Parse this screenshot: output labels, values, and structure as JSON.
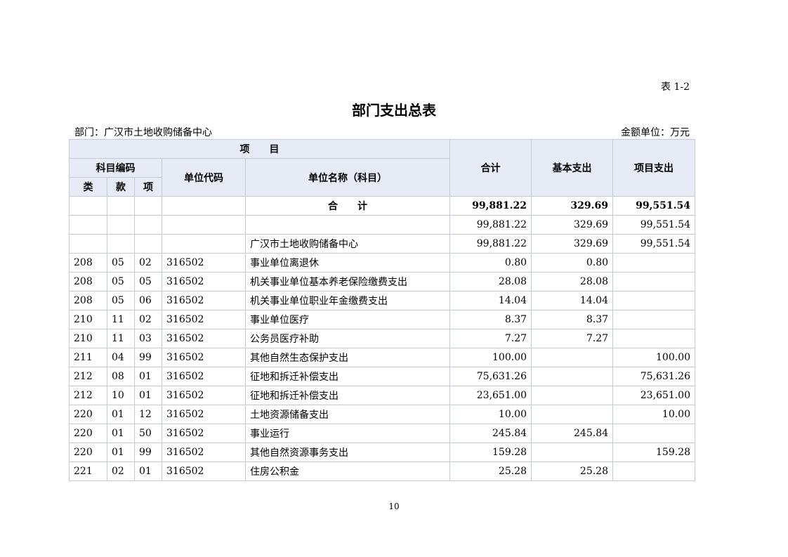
{
  "header": {
    "table_no": "表 1-2",
    "title": "部门支出总表",
    "dept": "部门：广汉市土地收购储备中心",
    "unit": "金额单位：万元"
  },
  "columns": {
    "project": "项　　目",
    "subject_code": "科目编码",
    "lei": "类",
    "kuan": "款",
    "xiang": "项",
    "unit_code": "单位代码",
    "unit_name": "单位名称（科目）",
    "total": "合计",
    "basic": "基本支出",
    "project_exp": "项目支出"
  },
  "total_row": {
    "label": "合　　计",
    "total": "99,881.22",
    "basic": "329.69",
    "project": "99,551.54"
  },
  "rows": [
    {
      "lei": "",
      "kuan": "",
      "xiang": "",
      "code": "",
      "name": "",
      "total": "99,881.22",
      "basic": "329.69",
      "project": "99,551.54"
    },
    {
      "lei": "",
      "kuan": "",
      "xiang": "",
      "code": "",
      "name": "广汉市土地收购储备中心",
      "total": "99,881.22",
      "basic": "329.69",
      "project": "99,551.54"
    },
    {
      "lei": "208",
      "kuan": "05",
      "xiang": "02",
      "code": "316502",
      "name": "事业单位离退休",
      "total": "0.80",
      "basic": "0.80",
      "project": ""
    },
    {
      "lei": "208",
      "kuan": "05",
      "xiang": "05",
      "code": "316502",
      "name": "机关事业单位基本养老保险缴费支出",
      "total": "28.08",
      "basic": "28.08",
      "project": ""
    },
    {
      "lei": "208",
      "kuan": "05",
      "xiang": "06",
      "code": "316502",
      "name": "机关事业单位职业年金缴费支出",
      "total": "14.04",
      "basic": "14.04",
      "project": ""
    },
    {
      "lei": "210",
      "kuan": "11",
      "xiang": "02",
      "code": "316502",
      "name": "事业单位医疗",
      "total": "8.37",
      "basic": "8.37",
      "project": ""
    },
    {
      "lei": "210",
      "kuan": "11",
      "xiang": "03",
      "code": "316502",
      "name": "公务员医疗补助",
      "total": "7.27",
      "basic": "7.27",
      "project": ""
    },
    {
      "lei": "211",
      "kuan": "04",
      "xiang": "99",
      "code": "316502",
      "name": "其他自然生态保护支出",
      "total": "100.00",
      "basic": "",
      "project": "100.00"
    },
    {
      "lei": "212",
      "kuan": "08",
      "xiang": "01",
      "code": "316502",
      "name": "征地和拆迁补偿支出",
      "total": "75,631.26",
      "basic": "",
      "project": "75,631.26"
    },
    {
      "lei": "212",
      "kuan": "10",
      "xiang": "01",
      "code": "316502",
      "name": "征地和拆迁补偿支出",
      "total": "23,651.00",
      "basic": "",
      "project": "23,651.00"
    },
    {
      "lei": "220",
      "kuan": "01",
      "xiang": "12",
      "code": "316502",
      "name": "土地资源储备支出",
      "total": "10.00",
      "basic": "",
      "project": "10.00"
    },
    {
      "lei": "220",
      "kuan": "01",
      "xiang": "50",
      "code": "316502",
      "name": "事业运行",
      "total": "245.84",
      "basic": "245.84",
      "project": ""
    },
    {
      "lei": "220",
      "kuan": "01",
      "xiang": "99",
      "code": "316502",
      "name": "其他自然资源事务支出",
      "total": "159.28",
      "basic": "",
      "project": "159.28"
    },
    {
      "lei": "221",
      "kuan": "02",
      "xiang": "01",
      "code": "316502",
      "name": "住房公积金",
      "total": "25.28",
      "basic": "25.28",
      "project": ""
    }
  ],
  "page_no": "10"
}
